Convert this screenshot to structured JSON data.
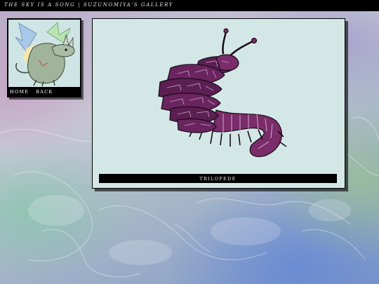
{
  "site": {
    "title": "THE SKY IS A SONG | SUZUNOMIYA'S GALLERY"
  },
  "nav": {
    "home_label": "HOME",
    "back_label": "BACK"
  },
  "artwork": {
    "caption": "TRILOPEDE",
    "icon": "trilopede-creature-illustration"
  },
  "colors": {
    "creature_body": "#7a2d6a",
    "creature_plate": "#5b1f52",
    "panel_bg": "#d3e8e6",
    "frame": "#000000"
  }
}
